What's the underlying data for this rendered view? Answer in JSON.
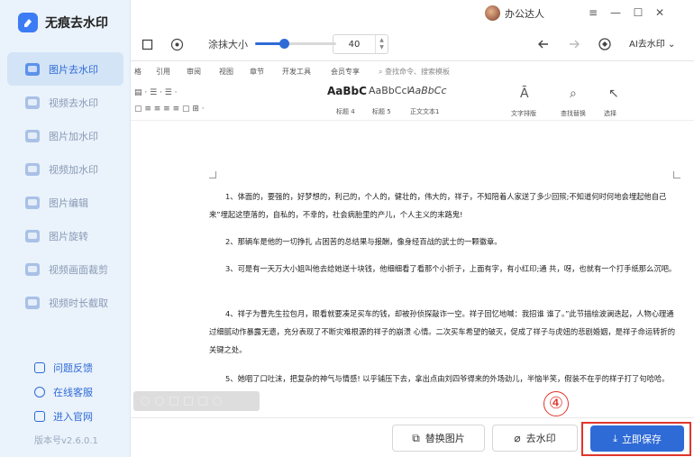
{
  "app": {
    "name": "无痕去水印",
    "version": "版本号v2.6.0.1"
  },
  "user": {
    "name": "办公达人"
  },
  "sidebar": {
    "items": [
      {
        "label": "图片去水印",
        "active": true
      },
      {
        "label": "视频去水印"
      },
      {
        "label": "图片加水印"
      },
      {
        "label": "视频加水印"
      },
      {
        "label": "图片编辑"
      },
      {
        "label": "图片旋转"
      },
      {
        "label": "视频画面裁剪"
      },
      {
        "label": "视频时长截取"
      }
    ],
    "links": [
      {
        "label": "问题反馈"
      },
      {
        "label": "在线客服"
      },
      {
        "label": "进入官网"
      }
    ]
  },
  "toolbar": {
    "brush_label": "涂抹大小",
    "brush_size": "40",
    "brush_fraction": 0.36,
    "ai_label": "AI去水印"
  },
  "doc": {
    "menu_tabs": [
      "格",
      "引用",
      "审阅",
      "视图",
      "章节",
      "开发工具",
      "会员专享"
    ],
    "search_cmd": "查找命令、搜索模板",
    "styles": [
      {
        "sample": "AaBbC",
        "caption": "标题 4"
      },
      {
        "sample": "AaBbCcl",
        "caption": "标题 5"
      },
      {
        "sample": "AaBbCc",
        "caption": "正文文本1"
      }
    ],
    "ribbon_tools": [
      "文字排版",
      "查找替换",
      "选择"
    ],
    "paragraphs": [
      "1、体面的，要强的，好梦想的，利己的，个人的，健壮的，伟大的，祥子，不知陪着人家送了多少回殡;不知道何时何地会埋起他自己来”埋起这堕落的，自私的，不幸的，社会病胎里的产儿，个人主义的末路鬼!",
      "2、那辆车是他的一切挣扎 占困苦的总结果与报酬，像身经百战的武士的一颗徽章。",
      "3、可是有一天万大小姐叫他去给她送十块钱，他细细看了看那个小折子，上面有字，有小红印;通 共，呀，也就有一个打手纸那么沉吧。",
      "4、祥子为曹先生拉包月，眼看就要凑足买车的钱，却被孙侦探敲诈一空。祥子回忆地喊：我招谁 谁了。”此节描绘波澜迭起，人物心理通过细腻动作暴露无遗，充分表现了不断灾难根源的祥子的崩溃 心情。二次买车希望的破灭，促成了祥子与虎妞的悲剧婚姻，是祥子命运转折的关键之处。",
      "5、她咽了口吐沫，把复杂的神气与情感! 以乎铺压下去，拿出点由刘四爷得来的外场劲儿，半恼半笑，假装不在乎的样子打了句哈哈。"
    ]
  },
  "bottom": {
    "replace_label": "替换图片",
    "remove_label": "去水印",
    "save_label": "立即保存",
    "step_number": "④"
  },
  "colors": {
    "accent": "#2f6bd6",
    "highlight": "#e0352b",
    "sidebar_bg": "#eaf2fb"
  }
}
